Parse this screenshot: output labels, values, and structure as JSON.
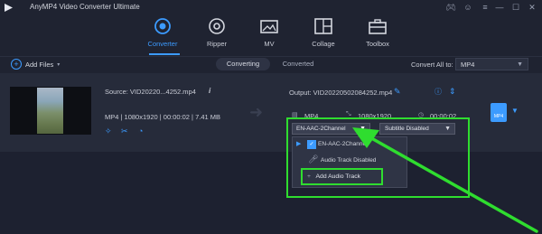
{
  "app": {
    "title": "AnyMP4 Video Converter Ultimate"
  },
  "nav": {
    "items": [
      {
        "label": "Converter"
      },
      {
        "label": "Ripper"
      },
      {
        "label": "MV"
      },
      {
        "label": "Collage"
      },
      {
        "label": "Toolbox"
      }
    ]
  },
  "toolbar": {
    "add_files": "Add Files",
    "tab_converting": "Converting",
    "tab_converted": "Converted",
    "convert_all_label": "Convert All to:",
    "convert_all_value": "MP4"
  },
  "file": {
    "source": "Source: VID20220...4252.mp4",
    "source_meta": "MP4 | 1080x1920 | 00:00:02 | 7.41 MB",
    "output": "Output: VID20220502084252.mp4",
    "output_format": "MP4",
    "output_resolution": "1080x1920",
    "output_duration": "00:00:02",
    "format_badge": "MP4"
  },
  "audio": {
    "selected": "EN-AAC-2Channel",
    "options": [
      {
        "label": "EN-AAC-2Channel",
        "checked": true
      },
      {
        "label": "Audio Track Disabled"
      },
      {
        "label": "Add Audio Track"
      }
    ]
  },
  "subtitle": {
    "selected": "Subtitle Disabled"
  },
  "colors": {
    "accent": "#3c9bff",
    "highlight": "#2fdd2f",
    "background": "#1a1e2b"
  }
}
